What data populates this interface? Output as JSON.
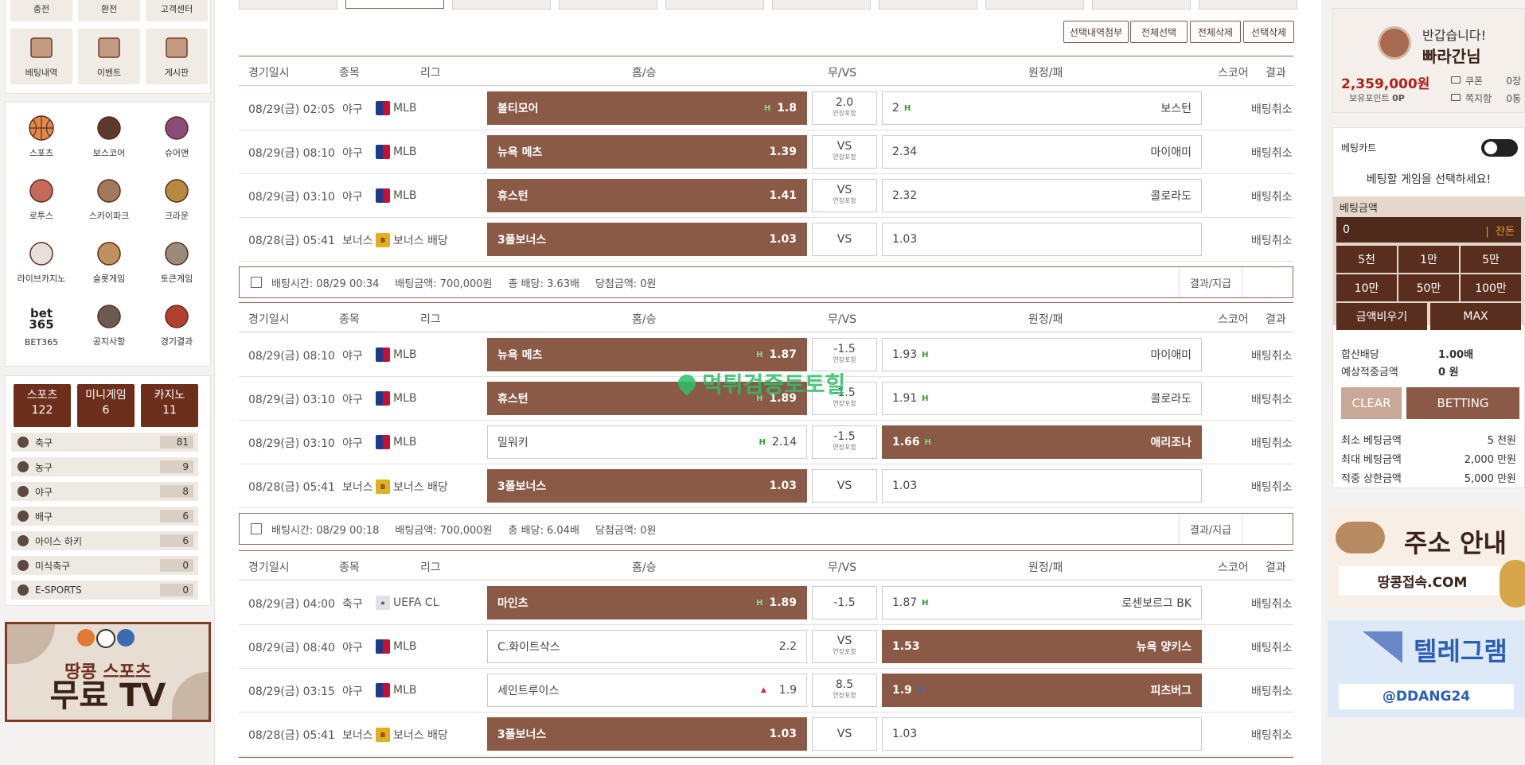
{
  "left": {
    "top_tiles": [
      {
        "label": "충전",
        "icon": "charge-icon"
      },
      {
        "label": "환전",
        "icon": "exchange-icon"
      },
      {
        "label": "고객센터",
        "icon": "support-icon"
      }
    ],
    "tiles_row2": [
      {
        "label": "베팅내역",
        "icon": "chart-icon"
      },
      {
        "label": "이벤트",
        "icon": "gift-icon"
      },
      {
        "label": "게시판",
        "icon": "speech-bubble-icon"
      }
    ],
    "game_tiles": [
      {
        "label": "스포츠",
        "icon": "basketball-icon"
      },
      {
        "label": "보스코어",
        "icon": "boscore-icon"
      },
      {
        "label": "슈어맨",
        "icon": "sureman-icon"
      },
      {
        "label": "로투스",
        "icon": "lotus-icon"
      },
      {
        "label": "스카이파크",
        "icon": "skypark-icon"
      },
      {
        "label": "크라운",
        "icon": "crown-icon"
      },
      {
        "label": "라이브카지노",
        "icon": "cards-icon"
      },
      {
        "label": "슬롯게임",
        "icon": "slot-icon"
      },
      {
        "label": "토큰게임",
        "icon": "dice-icon"
      },
      {
        "label": "BET365",
        "icon": "bet365-logo"
      },
      {
        "label": "공지사항",
        "icon": "megaphone-icon"
      },
      {
        "label": "경기결과",
        "icon": "results-chart-icon"
      }
    ],
    "bet365_text": "bet\n365",
    "category_tabs": [
      {
        "label": "스포츠",
        "count": "122"
      },
      {
        "label": "미니게임",
        "count": "6"
      },
      {
        "label": "카지노",
        "count": "11"
      }
    ],
    "sports": [
      {
        "label": "축구",
        "count": "81",
        "icon": "soccer-icon"
      },
      {
        "label": "농구",
        "count": "9",
        "icon": "basketball-icon"
      },
      {
        "label": "야구",
        "count": "8",
        "icon": "baseball-icon"
      },
      {
        "label": "배구",
        "count": "6",
        "icon": "volleyball-icon"
      },
      {
        "label": "아이스 하키",
        "count": "6",
        "icon": "hockey-icon"
      },
      {
        "label": "미식축구",
        "count": "0",
        "icon": "football-icon"
      },
      {
        "label": "E-SPORTS",
        "count": "0",
        "icon": "esports-icon"
      }
    ],
    "banner": {
      "line1": "땅콩 스포츠",
      "line2": "무료 TV"
    }
  },
  "toolbar": [
    "선택내역첨부",
    "전체선택",
    "전체삭제",
    "선택삭제"
  ],
  "headers": {
    "date": "경기일시",
    "sport": "종목",
    "league": "리그",
    "home": "홈/승",
    "mid": "무/VS",
    "away": "원정/패",
    "score": "스코어",
    "result": "결과"
  },
  "overtime": "연장포함",
  "groups": [
    {
      "rows": [
        {
          "date": "08/29(금) 02:05",
          "sport": "야구",
          "league": "MLB",
          "ltype": "mlb",
          "home": "볼티모어",
          "home_odds": "1.8",
          "home_up": "H",
          "home_sel": true,
          "mid": "2.0",
          "mid_sub": true,
          "away": "보스턴",
          "away_odds": "2",
          "away_up": "H",
          "away_sel": false,
          "away_order": "odds-first",
          "result": "배팅취소"
        },
        {
          "date": "08/29(금) 08:10",
          "sport": "야구",
          "league": "MLB",
          "ltype": "mlb",
          "home": "뉴욕 메츠",
          "home_odds": "1.39",
          "home_up": "",
          "home_sel": true,
          "mid": "VS",
          "mid_sub": true,
          "away": "마이애미",
          "away_odds": "2.34",
          "away_up": "",
          "away_sel": false,
          "result": "배팅취소"
        },
        {
          "date": "08/29(금) 03:10",
          "sport": "야구",
          "league": "MLB",
          "ltype": "mlb",
          "home": "휴스턴",
          "home_odds": "1.41",
          "home_up": "",
          "home_sel": true,
          "mid": "VS",
          "mid_sub": true,
          "away": "콜로라도",
          "away_odds": "2.32",
          "away_up": "",
          "away_sel": false,
          "result": "배팅취소"
        },
        {
          "date": "08/28(금) 05:41",
          "sport": "보너스",
          "league": "보너스 배당",
          "ltype": "bonus",
          "home": "3폴보너스",
          "home_odds": "1.03",
          "home_up": "",
          "home_sel": true,
          "mid": "VS",
          "mid_sub": false,
          "away": "",
          "away_odds": "1.03",
          "away_up": "",
          "away_sel": false,
          "result": "배팅취소"
        }
      ],
      "summary": {
        "time": "배팅시간: 08/29 00:34",
        "amount": "배팅금액: 700,000원",
        "total": "총 배당: 3.63배",
        "win": "당첨금액: 0원",
        "result": "결과/지급"
      }
    },
    {
      "rows": [
        {
          "date": "08/29(금) 08:10",
          "sport": "야구",
          "league": "MLB",
          "ltype": "mlb",
          "home": "뉴욕 메츠",
          "home_odds": "1.87",
          "home_up": "H",
          "home_sel": true,
          "mid": "-1.5",
          "mid_sub": true,
          "away": "마이애미",
          "away_odds": "1.93",
          "away_up": "H",
          "away_sel": false,
          "result": "배팅취소"
        },
        {
          "date": "08/29(금) 03:10",
          "sport": "야구",
          "league": "MLB",
          "ltype": "mlb",
          "home": "휴스턴",
          "home_odds": "1.89",
          "home_up": "H",
          "home_sel": true,
          "mid": "-1.5",
          "mid_sub": true,
          "away": "콜로라도",
          "away_odds": "1.91",
          "away_up": "H",
          "away_sel": false,
          "result": "배팅취소"
        },
        {
          "date": "08/29(금) 03:10",
          "sport": "야구",
          "league": "MLB",
          "ltype": "mlb",
          "home": "밀워키",
          "home_odds": "2.14",
          "home_up": "H",
          "home_sel": false,
          "mid": "-1.5",
          "mid_sub": true,
          "away": "애리조나",
          "away_odds": "1.66",
          "away_up": "H",
          "away_sel": true,
          "result": "배팅취소"
        },
        {
          "date": "08/28(금) 05:41",
          "sport": "보너스",
          "league": "보너스 배당",
          "ltype": "bonus",
          "home": "3폴보너스",
          "home_odds": "1.03",
          "home_up": "",
          "home_sel": true,
          "mid": "VS",
          "mid_sub": false,
          "away": "",
          "away_odds": "1.03",
          "away_up": "",
          "away_sel": false,
          "result": "배팅취소"
        }
      ],
      "summary": {
        "time": "배팅시간: 08/29 00:18",
        "amount": "배팅금액: 700,000원",
        "total": "총 배당: 6.04배",
        "win": "당첨금액: 0원",
        "result": "결과/지급"
      }
    },
    {
      "rows": [
        {
          "date": "08/29(금) 04:00",
          "sport": "축구",
          "league": "UEFA CL",
          "ltype": "uefa",
          "home": "마인츠",
          "home_odds": "1.89",
          "home_up": "H",
          "home_sel": true,
          "mid": "-1.5",
          "mid_sub": false,
          "away": "로센보르그 BK",
          "away_odds": "1.87",
          "away_up": "H",
          "away_sel": false,
          "result": "배팅취소"
        },
        {
          "date": "08/29(금) 08:40",
          "sport": "야구",
          "league": "MLB",
          "ltype": "mlb",
          "home": "C.화이트삭스",
          "home_odds": "2.2",
          "home_up": "",
          "home_sel": false,
          "mid": "VS",
          "mid_sub": true,
          "away": "뉴욕 양키스",
          "away_odds": "1.53",
          "away_up": "",
          "away_sel": true,
          "result": "배팅취소"
        },
        {
          "date": "08/29(금) 03:15",
          "sport": "야구",
          "league": "MLB",
          "ltype": "mlb",
          "home": "세인트루이스",
          "home_odds": "1.9",
          "home_up": "up",
          "home_sel": false,
          "mid": "8.5",
          "mid_sub": true,
          "away": "피츠버그",
          "away_odds": "1.9",
          "away_up": "down",
          "away_sel": true,
          "result": "배팅취소"
        },
        {
          "date": "08/28(금) 05:41",
          "sport": "보너스",
          "league": "보너스 배당",
          "ltype": "bonus",
          "home": "3폴보너스",
          "home_odds": "1.03",
          "home_up": "",
          "home_sel": true,
          "mid": "VS",
          "mid_sub": false,
          "away": "",
          "away_odds": "1.03",
          "away_up": "",
          "away_sel": false,
          "result": "배팅취소"
        }
      ]
    }
  ],
  "watermark": "먹튀검증토토힐",
  "right": {
    "greeting": "반갑습니다!",
    "username": "빠라간님",
    "balance": "2,359,000원",
    "points_label": "보유포인트",
    "points": "0P",
    "coupon_label": "쿠폰",
    "coupon_count": "0장",
    "note_label": "쪽지함",
    "note_count": "0통",
    "cart_title": "베팅카트",
    "cart_msg": "베팅할 게임을 선택하세요!",
    "amount_label": "베팅금액",
    "amount_value": "0",
    "balance_link": "잔돈",
    "amount_buttons": [
      "5천",
      "1만",
      "5만",
      "10만",
      "50만",
      "100만"
    ],
    "clear_amount": "금액비우기",
    "max": "MAX",
    "total_odds_label": "합산배당",
    "total_odds": "1.00배",
    "expected_label": "예상적중금액",
    "expected": "0 원",
    "clear_btn": "CLEAR",
    "betting_btn": "BETTING",
    "limits": [
      {
        "label": "최소 베팅금액",
        "value": "5 천원"
      },
      {
        "label": "최대 베팅금액",
        "value": "2,000 만원"
      },
      {
        "label": "적중 상한금액",
        "value": "5,000 만원"
      }
    ],
    "banner1": {
      "title": "주소 안내",
      "sub": "땅콩접속.COM"
    },
    "banner2": {
      "title": "텔레그램",
      "sub": "@DDANG24"
    }
  }
}
